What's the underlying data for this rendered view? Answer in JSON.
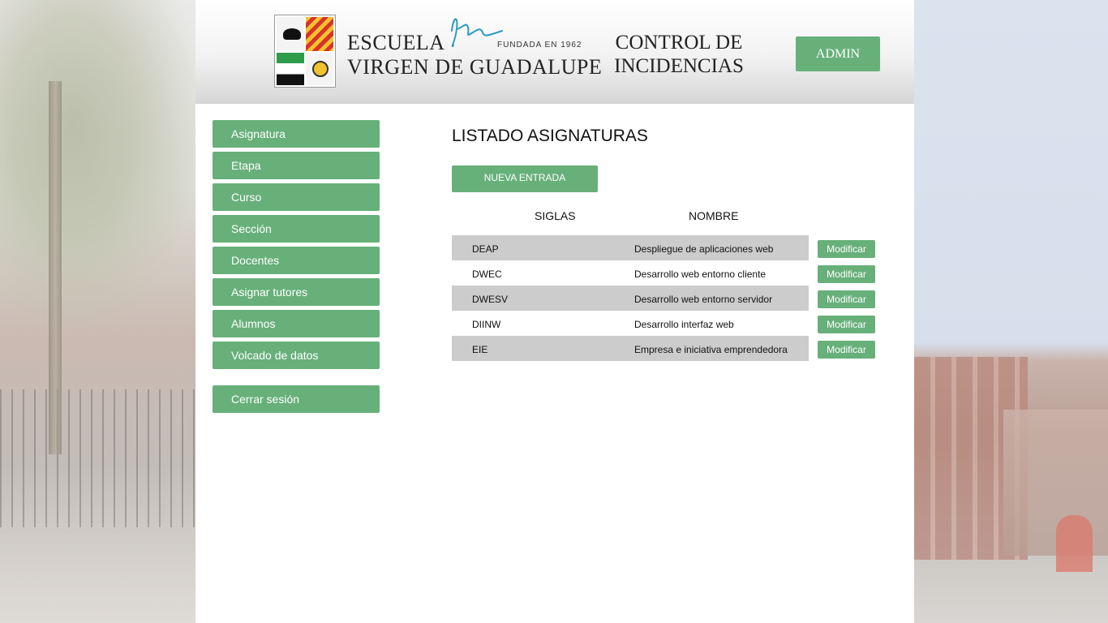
{
  "header": {
    "school_line1": "ESCUELA",
    "school_line2": "VIRGEN DE GUADALUPE",
    "founded": "FUNDADA EN 1962",
    "title_line1": "CONTROL DE",
    "title_line2": "INCIDENCIAS",
    "admin_label": "ADMIN"
  },
  "sidebar": {
    "items": [
      {
        "label": "Asignatura"
      },
      {
        "label": "Etapa"
      },
      {
        "label": "Curso"
      },
      {
        "label": "Sección"
      },
      {
        "label": "Docentes"
      },
      {
        "label": "Asignar tutores"
      },
      {
        "label": "Alumnos"
      },
      {
        "label": "Volcado de datos"
      }
    ],
    "logout_label": "Cerrar sesión"
  },
  "main": {
    "title": "LISTADO ASIGNATURAS",
    "new_entry_label": "NUEVA ENTRADA",
    "columns": {
      "siglas": "SIGLAS",
      "nombre": "NOMBRE"
    },
    "modify_label": "Modificar",
    "rows": [
      {
        "siglas": "DEAP",
        "nombre": "Despliegue de aplicaciones web"
      },
      {
        "siglas": "DWEC",
        "nombre": "Desarrollo web entorno cliente"
      },
      {
        "siglas": "DWESV",
        "nombre": "Desarrollo web entorno servidor"
      },
      {
        "siglas": "DIINW",
        "nombre": "Desarrollo interfaz web"
      },
      {
        "siglas": "EIE",
        "nombre": "Empresa e iniciativa emprendedora"
      }
    ]
  },
  "colors": {
    "accent": "#67b07a",
    "row_stripe": "#cccccc",
    "signature": "#2a9bc0"
  }
}
